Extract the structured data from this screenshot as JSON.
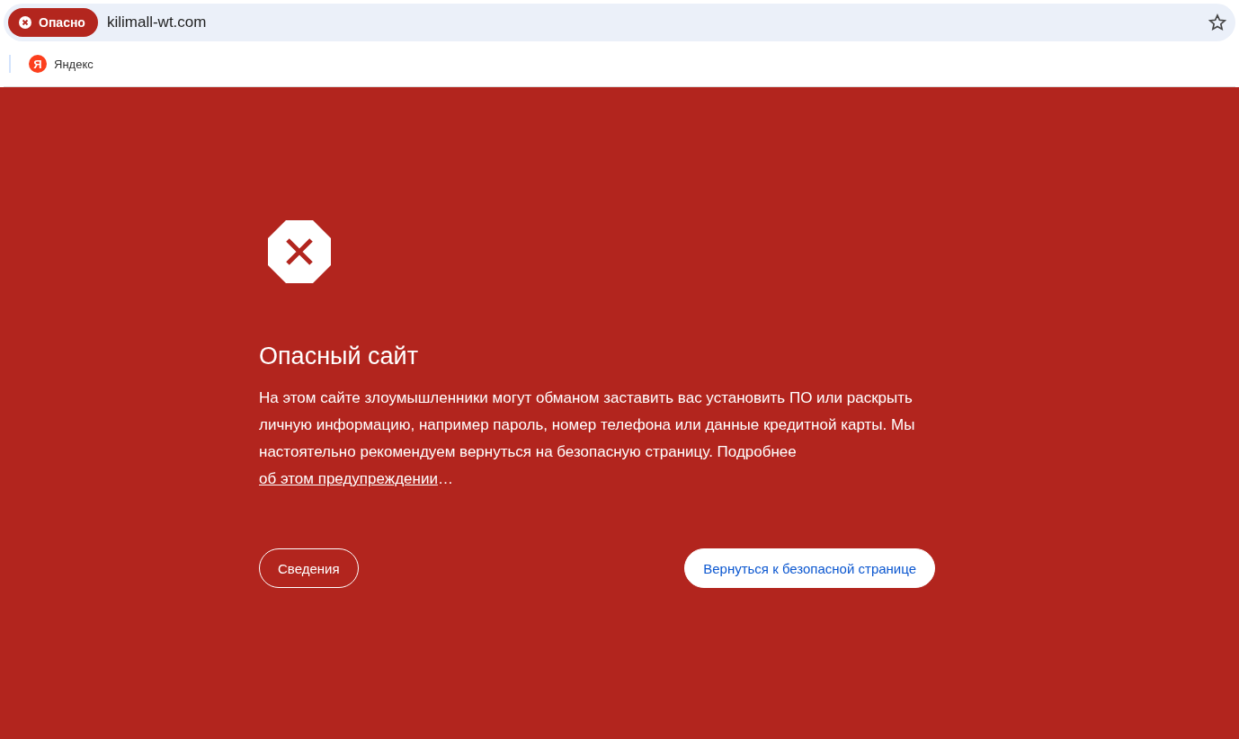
{
  "address_bar": {
    "security_chip": "Опасно",
    "url": "kilimall-wt.com",
    "bookmarked": false
  },
  "bookmarks": [
    {
      "label": "Яндекс",
      "icon_letter": "Я"
    }
  ],
  "warning": {
    "title": "Опасный сайт",
    "text": "На этом сайте злоумышленники могут обманом заставить вас установить ПО или раскрыть личную информацию, например пароль, номер телефона или данные кредитной карты. Мы настоятельно рекомендуем вернуться на безопасную страницу. Подробнее ",
    "link": "об этом предупреждении",
    "text_after": "…",
    "details_button": "Сведения",
    "back_button": "Вернуться к безопасной странице"
  }
}
